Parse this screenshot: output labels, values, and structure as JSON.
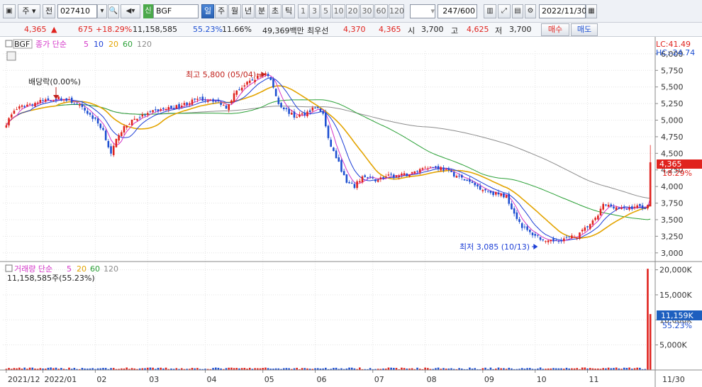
{
  "toolbar": {
    "period_type": "주",
    "prev_label": "전",
    "code": "027410",
    "name": "BGF",
    "badge": "신",
    "periods": [
      "일",
      "주",
      "월",
      "년",
      "분",
      "초",
      "틱"
    ],
    "active_period": "일",
    "intervals": [
      "1",
      "3",
      "5",
      "10",
      "20",
      "30",
      "60",
      "120"
    ],
    "count": "247",
    "count_total": "/600",
    "date": "2022/11/30"
  },
  "quote": {
    "price": "4,365",
    "change_arrow": "▲",
    "change": "675",
    "change_pct": "+18.29%",
    "volume": "11,158,585",
    "vol_ratio": "55.23%",
    "turnover": "11.66%",
    "amount": "49,369백만",
    "best_ask_label": "최우선",
    "best_ask": "4,370",
    "best_bid": "4,365",
    "open_label": "시",
    "open": "3,700",
    "high_label": "고",
    "high": "4,625",
    "low_label": "저",
    "low": "3,700",
    "buy_label": "매수",
    "sell_label": "매도"
  },
  "price_panel": {
    "symbol": "BGF",
    "legend_prefix": "종가 단순",
    "ma_periods": [
      "5",
      "10",
      "20",
      "60",
      "120"
    ],
    "lc": "LC:41.49",
    "hc": "HC:-24.74",
    "dividend_label": "배당락(0.00%)",
    "high_label": "최고 5,800 (05/04)",
    "low_label": "최저 3,085 (10/13)",
    "current_price": "4,365",
    "current_pct": "18.29%"
  },
  "volume_panel": {
    "legend_prefix": "거래량 단순",
    "ma_periods": [
      "5",
      "20",
      "60",
      "120"
    ],
    "current_text": "11,158,585주(55.23%)",
    "current_tag": "11,159K",
    "current_pct": "55.23%"
  },
  "colors": {
    "up": "#e0231e",
    "down": "#1d4fd1",
    "ma5": "#d436c8",
    "ma10": "#1d3fd6",
    "ma20": "#e3a400",
    "ma60": "#2aa036",
    "ma120": "#8c8c8c"
  },
  "chart_data": {
    "type": "candlestick",
    "price_axis": {
      "ticks": [
        3000,
        3250,
        3500,
        3750,
        4000,
        4250,
        4500,
        4750,
        5000,
        5250,
        5500,
        5750,
        6000
      ],
      "tick_labels": [
        "3,000",
        "3,250",
        "3,500",
        "3,750",
        "4,000",
        "4,250",
        "4,500",
        "4,750",
        "5,000",
        "5,250",
        "5,500",
        "5,750",
        "6,000"
      ],
      "range": [
        2880,
        6020
      ]
    },
    "volume_axis": {
      "ticks": [
        5000,
        10000,
        15000,
        20000
      ],
      "tick_labels": [
        "5,000K",
        "10,000K",
        "15,000K",
        "20,000K"
      ],
      "range": [
        0,
        21500
      ]
    },
    "time_axis": {
      "labels": [
        "2021/12",
        "2022/01",
        "02",
        "03",
        "04",
        "05",
        "06",
        "07",
        "08",
        "09",
        "10",
        "11",
        "11/30"
      ],
      "label_index": [
        0,
        14,
        34,
        54,
        76,
        98,
        118,
        140,
        160,
        182,
        202,
        222,
        246
      ],
      "total_bars": 247
    },
    "price_anchors": [
      [
        0,
        4950
      ],
      [
        3,
        5150
      ],
      [
        8,
        5230
      ],
      [
        15,
        5300
      ],
      [
        20,
        5330
      ],
      [
        25,
        5280
      ],
      [
        30,
        5150
      ],
      [
        34,
        5000
      ],
      [
        37,
        4850
      ],
      [
        40,
        4480
      ],
      [
        43,
        4800
      ],
      [
        48,
        5000
      ],
      [
        53,
        5080
      ],
      [
        58,
        5150
      ],
      [
        65,
        5200
      ],
      [
        72,
        5300
      ],
      [
        78,
        5320
      ],
      [
        82,
        5250
      ],
      [
        84,
        5200
      ],
      [
        88,
        5450
      ],
      [
        92,
        5550
      ],
      [
        96,
        5650
      ],
      [
        99,
        5720
      ],
      [
        101,
        5600
      ],
      [
        104,
        5250
      ],
      [
        107,
        5150
      ],
      [
        110,
        5050
      ],
      [
        114,
        5100
      ],
      [
        118,
        5200
      ],
      [
        121,
        5100
      ],
      [
        123,
        4700
      ],
      [
        127,
        4350
      ],
      [
        130,
        4050
      ],
      [
        133,
        4000
      ],
      [
        136,
        4150
      ],
      [
        141,
        4100
      ],
      [
        145,
        4150
      ],
      [
        150,
        4160
      ],
      [
        155,
        4200
      ],
      [
        160,
        4300
      ],
      [
        166,
        4280
      ],
      [
        170,
        4200
      ],
      [
        175,
        4100
      ],
      [
        181,
        3980
      ],
      [
        186,
        3900
      ],
      [
        191,
        3850
      ],
      [
        194,
        3600
      ],
      [
        197,
        3400
      ],
      [
        200,
        3300
      ],
      [
        203,
        3250
      ],
      [
        206,
        3150
      ],
      [
        209,
        3180
      ],
      [
        214,
        3220
      ],
      [
        218,
        3250
      ],
      [
        222,
        3400
      ],
      [
        225,
        3500
      ],
      [
        228,
        3720
      ],
      [
        232,
        3700
      ],
      [
        236,
        3650
      ],
      [
        240,
        3700
      ],
      [
        244,
        3690
      ],
      [
        245,
        3700
      ],
      [
        246,
        4365
      ]
    ],
    "annotations": [
      {
        "text": "최고 5,800 (05/04)",
        "price": 5800,
        "bar": 99
      },
      {
        "text": "최저 3,085 (10/13)",
        "price": 3085,
        "bar": 203
      },
      {
        "text": "배당락(0.00%)",
        "bar": 19
      }
    ],
    "last_bar": {
      "open": 3700,
      "high": 4625,
      "low": 3700,
      "close": 4365,
      "volume_k": 11159
    },
    "prev_bar_volume_k": 20200
  }
}
